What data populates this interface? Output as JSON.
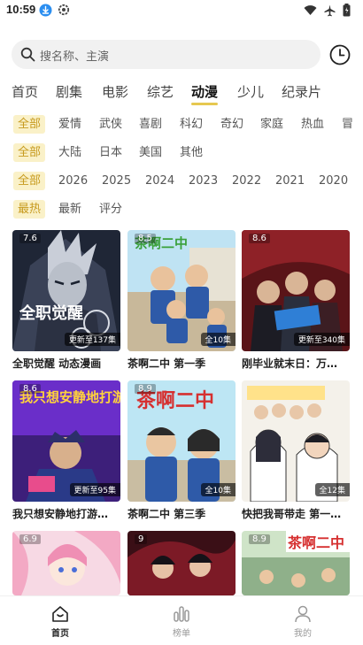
{
  "status": {
    "time": "10:59"
  },
  "search": {
    "placeholder": "搜名称、主演"
  },
  "tabs": [
    {
      "label": "首页",
      "active": false
    },
    {
      "label": "剧集",
      "active": false
    },
    {
      "label": "电影",
      "active": false
    },
    {
      "label": "综艺",
      "active": false
    },
    {
      "label": "动漫",
      "active": true
    },
    {
      "label": "少儿",
      "active": false
    },
    {
      "label": "纪录片",
      "active": false
    }
  ],
  "filters": {
    "genre": [
      "全部",
      "爱情",
      "武侠",
      "喜剧",
      "科幻",
      "奇幻",
      "家庭",
      "热血",
      "冒"
    ],
    "region": [
      "全部",
      "大陆",
      "日本",
      "美国",
      "其他"
    ],
    "year": [
      "全部",
      "2026",
      "2025",
      "2024",
      "2023",
      "2022",
      "2021",
      "2020"
    ],
    "sort": [
      "最热",
      "最新",
      "评分"
    ]
  },
  "cards": [
    {
      "score": "7.6",
      "badge": "更新至137集",
      "title": "全职觉醒 动态漫画",
      "poster_text": "全职觉醒"
    },
    {
      "score": "8.5",
      "badge": "全10集",
      "title": "茶啊二中 第一季",
      "poster_text": "茶啊二中"
    },
    {
      "score": "8.6",
      "badge": "更新至340集",
      "title": "刚毕业就末日：万…",
      "poster_text": ""
    },
    {
      "score": "8.6",
      "badge": "更新至95集",
      "title": "我只想安静地打游…",
      "poster_text": "我只想安静地打游戏"
    },
    {
      "score": "8.9",
      "badge": "全10集",
      "title": "茶啊二中 第三季",
      "poster_text": "茶啊二中"
    },
    {
      "score": "",
      "badge": "全12集",
      "title": "快把我哥带走 第一…",
      "poster_text": ""
    },
    {
      "score": "6.9",
      "badge": "",
      "title": "",
      "poster_text": ""
    },
    {
      "score": "9",
      "badge": "",
      "title": "",
      "poster_text": ""
    },
    {
      "score": "8.9",
      "badge": "",
      "title": "",
      "poster_text": "茶啊二中"
    }
  ],
  "bottom_nav": [
    {
      "label": "首页",
      "icon": "home-icon",
      "active": true
    },
    {
      "label": "榜单",
      "icon": "chart-icon",
      "active": false
    },
    {
      "label": "我的",
      "icon": "user-icon",
      "active": false
    }
  ],
  "colors": {
    "accent": "#e6c850",
    "chip_bg": "#faf1c8",
    "chip_text": "#c79a1e"
  }
}
